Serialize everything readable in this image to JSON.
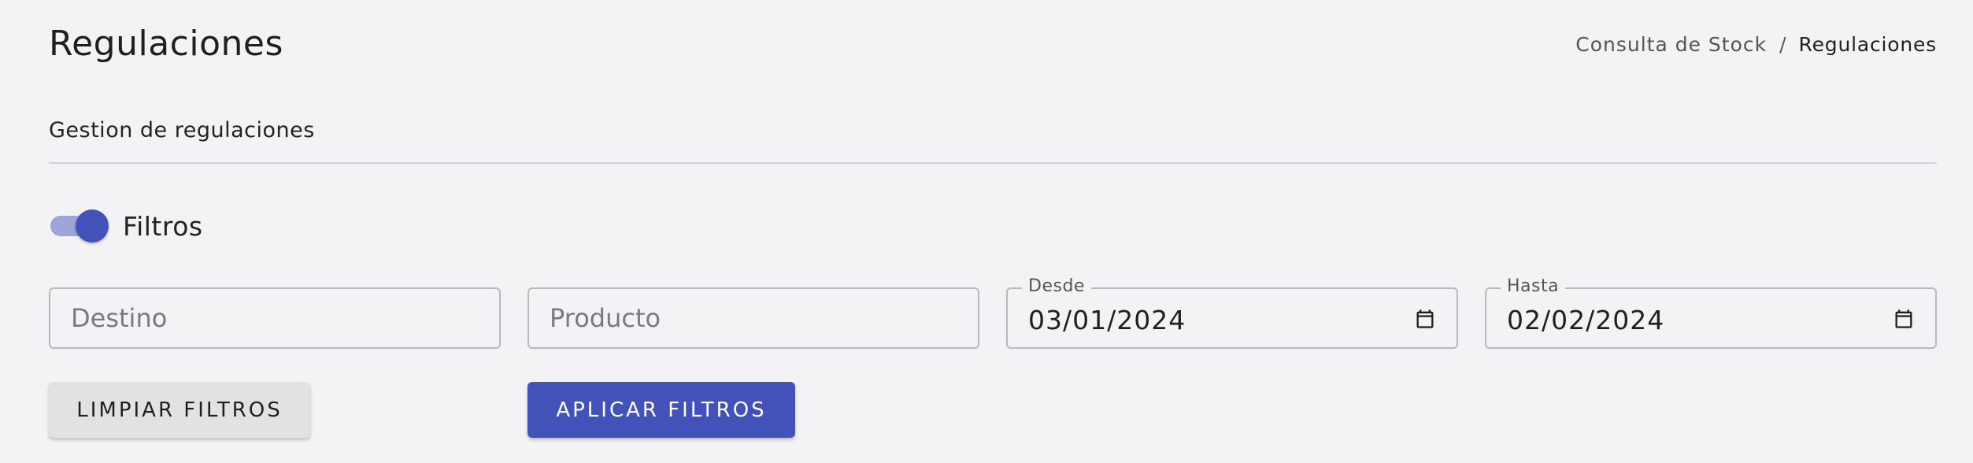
{
  "header": {
    "title": "Regulaciones",
    "breadcrumb": {
      "link": "Consulta de Stock",
      "separator": "/",
      "current": "Regulaciones"
    }
  },
  "section": {
    "subtitle": "Gestion de regulaciones"
  },
  "filters_toggle": {
    "label": "Filtros",
    "checked": true
  },
  "fields": {
    "destino": {
      "placeholder": "Destino",
      "value": ""
    },
    "producto": {
      "placeholder": "Producto",
      "value": ""
    },
    "desde": {
      "label": "Desde",
      "value": "03/01/2024"
    },
    "hasta": {
      "label": "Hasta",
      "value": "02/02/2024"
    }
  },
  "buttons": {
    "clear_label": "LIMPIAR FILTROS",
    "apply_label": "APLICAR FILTROS"
  },
  "icons": {
    "date_picker": "calendar-icon"
  },
  "colors": {
    "primary": "#4352b8",
    "toggle_track": "#9ea3d8",
    "background": "#f3f3f5",
    "secondary_button": "#e2e2e4"
  }
}
